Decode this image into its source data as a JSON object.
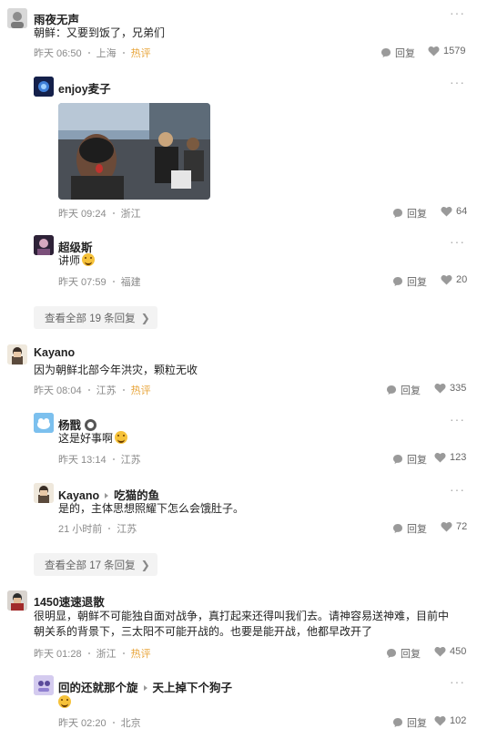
{
  "icons": {
    "reply": "reply-bubble-icon",
    "like": "heart-icon",
    "more": "more-dots-icon"
  },
  "comments": [
    {
      "name": "雨夜无声",
      "text": "朝鲜：又要到饭了，兄弟们",
      "time": "昨天 06:50",
      "location": "上海",
      "hot": "热评",
      "reply_label": "回复",
      "likes": "1579",
      "replies": [
        {
          "name": "enjoy麦子",
          "time": "昨天 09:24",
          "location": "浙江",
          "reply_label": "回复",
          "likes": "64"
        },
        {
          "name": "超级斯",
          "text": "讲师",
          "time": "昨天 07:59",
          "location": "福建",
          "reply_label": "回复",
          "likes": "20"
        }
      ],
      "view_all": "查看全部 19 条回复"
    },
    {
      "name": "Kayano",
      "text": "因为朝鲜北部今年洪灾，颗粒无收",
      "time": "昨天 08:04",
      "location": "江苏",
      "hot": "热评",
      "reply_label": "回复",
      "likes": "335",
      "replies": [
        {
          "name": "杨戬",
          "text": "这是好事啊",
          "time": "昨天 13:14",
          "location": "江苏",
          "reply_label": "回复",
          "likes": "123"
        },
        {
          "name": "Kayano",
          "reply_to": "吃猫的鱼",
          "text": "是的，主体思想照耀下怎么会饿肚子。",
          "time": "21 小时前",
          "location": "江苏",
          "reply_label": "回复",
          "likes": "72"
        }
      ],
      "view_all": "查看全部 17 条回复"
    },
    {
      "name": "1450速速退散",
      "text_line1": "很明显，朝鲜不可能独自面对战争，真打起来还得叫我们去。请神容易送神难，目前中",
      "text_line2": "朝关系的背景下，三太阳不可能开战的。也要是能开战，他都早改开了",
      "time": "昨天 01:28",
      "location": "浙江",
      "hot": "热评",
      "reply_label": "回复",
      "likes": "450",
      "replies": [
        {
          "name": "回的还就那个旋",
          "reply_to": "天上掉下个狗子",
          "time": "昨天 02:20",
          "location": "北京",
          "reply_label": "回复",
          "likes": "102"
        }
      ]
    }
  ]
}
